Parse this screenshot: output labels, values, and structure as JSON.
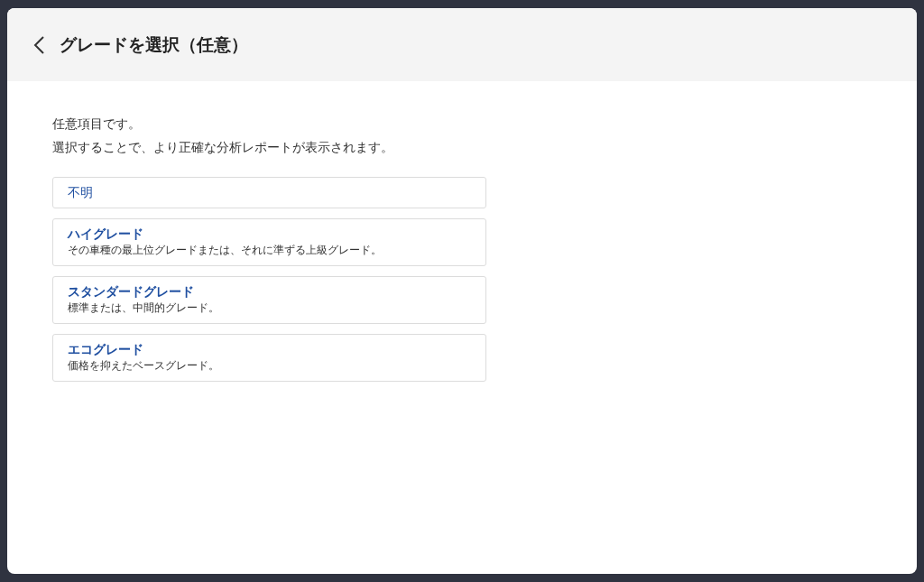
{
  "dialog": {
    "title": "グレードを選択（任意）",
    "intro": [
      "任意項目です。",
      "選択することで、より正確な分析レポートが表示されます。"
    ],
    "options": [
      {
        "title": "不明",
        "selected": false
      },
      {
        "title": "ハイグレード",
        "description": "その車種の最上位グレードまたは、それに準ずる上級グレード。",
        "selected": false
      },
      {
        "title": "スタンダードグレード",
        "description": "標準または、中間的グレード。",
        "selected": false
      },
      {
        "title": "エコグレード",
        "description": "価格を抑えたベースグレード。",
        "selected": false
      }
    ]
  }
}
